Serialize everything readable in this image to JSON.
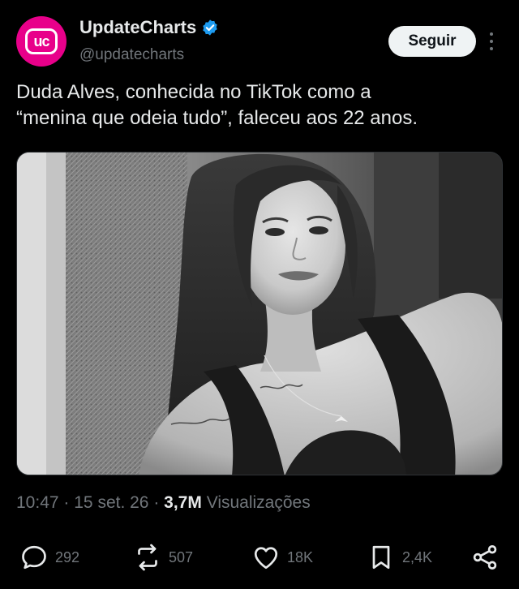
{
  "author": {
    "name": "UpdateCharts",
    "handle": "@updatecharts",
    "avatar_text": "uc",
    "verified": true,
    "avatar_color": "#e8008a",
    "verified_color": "#1d9bf0"
  },
  "follow_button": {
    "label": "Seguir"
  },
  "more_button": {
    "icon": "more-vertical-icon"
  },
  "post": {
    "text_line1": "Duda Alves, conhecida no TikTok como a",
    "text_line2": "“menina que odeia tudo”, faleceu aos 22 anos.",
    "image": {
      "style": "black-and-white portrait photo"
    }
  },
  "meta": {
    "time": "10:47",
    "separator": "·",
    "date": "15 set. 26",
    "views_count": "3,7M",
    "views_label": "Visualizações"
  },
  "actions": {
    "reply": {
      "icon": "reply-icon",
      "count": "292"
    },
    "repost": {
      "icon": "repost-icon",
      "count": "507"
    },
    "like": {
      "icon": "like-icon",
      "count": "18K"
    },
    "bookmark": {
      "icon": "bookmark-icon",
      "count": "2,4K"
    },
    "share": {
      "icon": "share-icon"
    }
  },
  "colors": {
    "background": "#000000",
    "text_primary": "#e7e9ea",
    "text_secondary": "#71767b",
    "button_bg": "#eff3f4"
  }
}
